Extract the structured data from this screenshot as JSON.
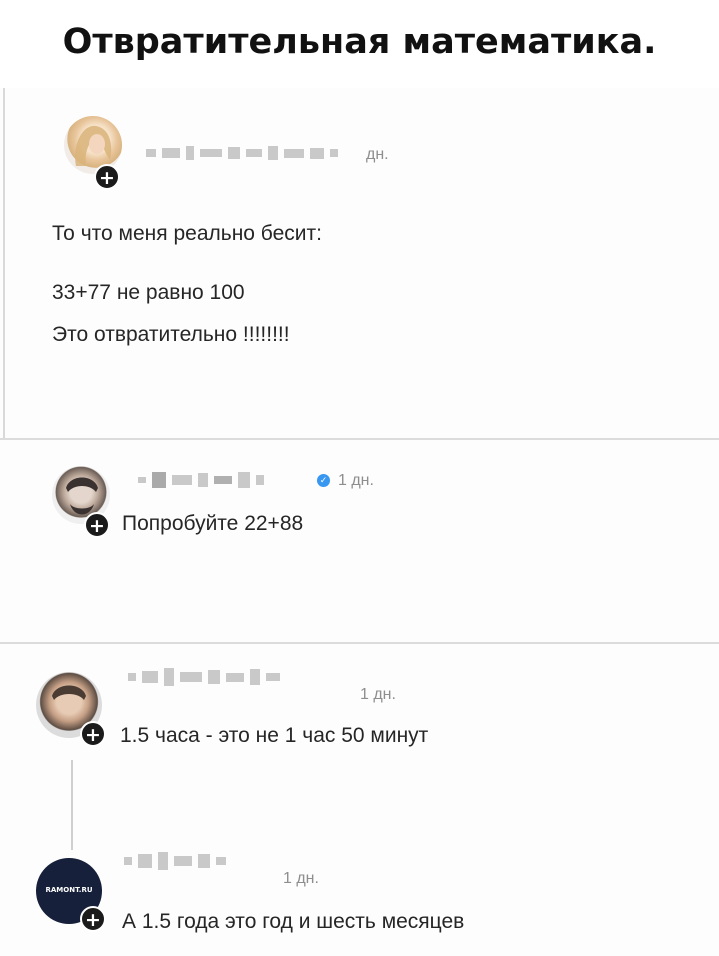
{
  "caption": "Отвратительная математика.",
  "post": {
    "time": "дн.",
    "lines": [
      "То что меня реально бесит:",
      "33+77 не равно 100",
      "Это отвратительно !!!!!!!!"
    ]
  },
  "comments": [
    {
      "time": "1 дн.",
      "text": "Попробуйте 22+88",
      "verified": true
    },
    {
      "time": "1 дн.",
      "text": "1.5 часа - это не 1 час 50 минут"
    },
    {
      "time": "1 дн.",
      "text": "А 1.5 года это год и шесть месяцев",
      "avatar_text": "RAMONT.RU"
    }
  ],
  "icons": {
    "follow": "plus-icon",
    "verified": "verified-badge-icon"
  },
  "colors": {
    "verified": "#3897f0",
    "plus_badge": "#1b1b1b"
  }
}
